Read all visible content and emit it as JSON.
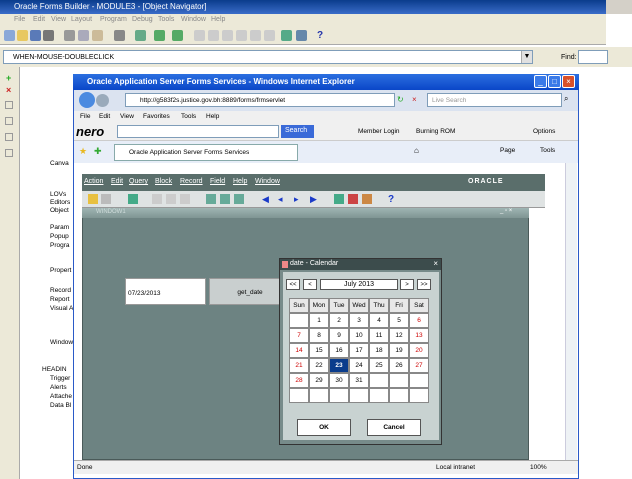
{
  "builder": {
    "title": "Oracle Forms Builder - MODULE3 - [Object Navigator]",
    "menu": [
      "File",
      "Edit",
      "View",
      "Layout",
      "Program",
      "Debug",
      "Tools",
      "Window",
      "Help"
    ],
    "trigger": "WHEN-MOUSE-DOUBLECLICK",
    "find_label": "Find:",
    "tree": [
      "Canva",
      "LOVs",
      "Editors",
      "Object",
      "Param",
      "Popup",
      "Progra",
      "Propert",
      "Record",
      "Report",
      "Visual A",
      "Window",
      "HEADIN",
      "Trigger",
      "Alerts",
      "Attache",
      "Data Bl"
    ]
  },
  "browser": {
    "title": "Oracle Application Server Forms Services - Windows Internet Explorer",
    "address": "http://g583f2s.justice.gov.bh:8889/forms/frmservlet",
    "search_placeholder": "Live Search",
    "menu": [
      "File",
      "Edit",
      "View",
      "Favorites",
      "Tools",
      "Help"
    ],
    "nero": {
      "logo": "nero",
      "search": "Search",
      "member": "Member Login",
      "burn": "Burning ROM",
      "options": "Options"
    },
    "tab": "Oracle Application Server Forms Services",
    "page": "Page",
    "tools": "Tools",
    "status": {
      "left": "Done",
      "zone": "Local intranet",
      "zoom": "100%"
    }
  },
  "forms": {
    "menu": [
      "Action",
      "Edit",
      "Query",
      "Block",
      "Record",
      "Field",
      "Help",
      "Window"
    ],
    "logo": "ORACLE",
    "window_title": "WINDOW1",
    "date_value": "07/23/2013",
    "get_date": "get_date"
  },
  "calendar": {
    "title": "date -",
    "subtitle": "Calendar",
    "prev_year": "<<",
    "prev": "<",
    "month": "July 2013",
    "next": ">",
    "next_year": ">>",
    "days": [
      "Sun",
      "Mon",
      "Tue",
      "Wed",
      "Thu",
      "Fri",
      "Sat"
    ],
    "rows": [
      [
        "",
        "1",
        "2",
        "3",
        "4",
        "5",
        "6"
      ],
      [
        "7",
        "8",
        "9",
        "10",
        "11",
        "12",
        "13"
      ],
      [
        "14",
        "15",
        "16",
        "17",
        "18",
        "19",
        "20"
      ],
      [
        "21",
        "22",
        "23",
        "24",
        "25",
        "26",
        "27"
      ],
      [
        "28",
        "29",
        "30",
        "31",
        "",
        "",
        ""
      ],
      [
        "",
        "",
        "",
        "",
        "",
        "",
        ""
      ]
    ],
    "selected": "23",
    "ok": "OK",
    "cancel": "Cancel"
  }
}
